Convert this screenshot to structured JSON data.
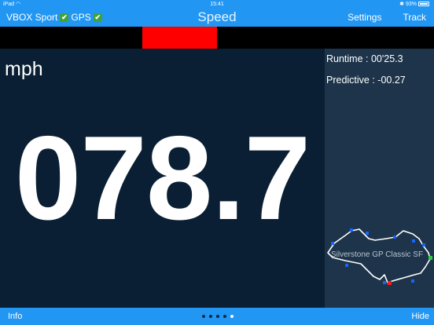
{
  "status_bar": {
    "device": "iPad",
    "time": "15:41",
    "battery": "93%"
  },
  "nav": {
    "logger": "VBOX Sport",
    "gps": "GPS",
    "check_mark": "✔",
    "title": "Speed",
    "settings_label": "Settings",
    "track_label": "Track"
  },
  "delta_bar": {
    "color": "#ff0000"
  },
  "speed": {
    "unit": "mph",
    "value": "078.7"
  },
  "stats": {
    "runtime": "Runtime : 00'25.3",
    "predictive": "Predictive : -00.27"
  },
  "track": {
    "name": "Silverstone GP Classic SF"
  },
  "bottom_bar": {
    "info_label": "Info",
    "hide_label": "Hide",
    "page_count": 5,
    "current_page": 5
  },
  "colors": {
    "accent": "#2196f3",
    "panel": "#0b1f33",
    "side_panel": "#1d344a"
  }
}
